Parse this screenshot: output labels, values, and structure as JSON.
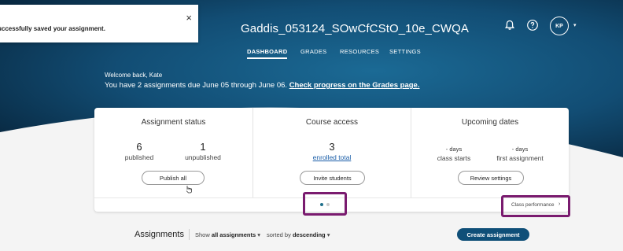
{
  "toast": {
    "message": "uccessfully saved your assignment.",
    "close_icon": "×"
  },
  "header": {
    "course_title": "Gaddis_053124_SOwCfCStO_10e_CWQA",
    "notifications_icon": "bell-icon",
    "help_icon": "help-circle-icon",
    "avatar_initials": "KP",
    "avatar_caret": "▾"
  },
  "nav": {
    "tabs": [
      {
        "label": "DASHBOARD",
        "active": true
      },
      {
        "label": "GRADES",
        "active": false
      },
      {
        "label": "RESOURCES",
        "active": false
      },
      {
        "label": "SETTINGS",
        "active": false
      }
    ]
  },
  "welcome": {
    "greeting": "Welcome back, Kate",
    "due_text": "You have 2 assignments due June 05 through June 06.",
    "progress_link": "Check progress on the Grades page."
  },
  "status_card": {
    "assignment_status": {
      "title": "Assignment status",
      "published_count": "6",
      "published_label": "published",
      "unpublished_count": "1",
      "unpublished_label": "unpublished",
      "button": "Publish all"
    },
    "course_access": {
      "title": "Course access",
      "enrolled_count": "3",
      "enrolled_link": "enrolled total",
      "button": "Invite students"
    },
    "upcoming_dates": {
      "title": "Upcoming dates",
      "class_starts_value": "- days",
      "class_starts_label": "class starts",
      "first_assignment_value": "- days",
      "first_assignment_label": "first assignment",
      "button": "Review settings"
    },
    "footer": {
      "class_performance": "Class performance",
      "chevron": "›",
      "carousel_page": 1,
      "carousel_total": 2
    }
  },
  "assignments_bar": {
    "title": "Assignments",
    "show_prefix": "Show",
    "show_value": "all assignments",
    "sort_prefix": "sorted by",
    "sort_value": "descending",
    "dropdown_caret": "▾",
    "create_button": "Create assignment"
  },
  "colors": {
    "hero_dark": "#0a2f4a",
    "hero_light": "#1b6a95",
    "primary_button": "#0f4f78",
    "highlight_box": "#7a1b6f",
    "link": "#1a5ea8"
  }
}
